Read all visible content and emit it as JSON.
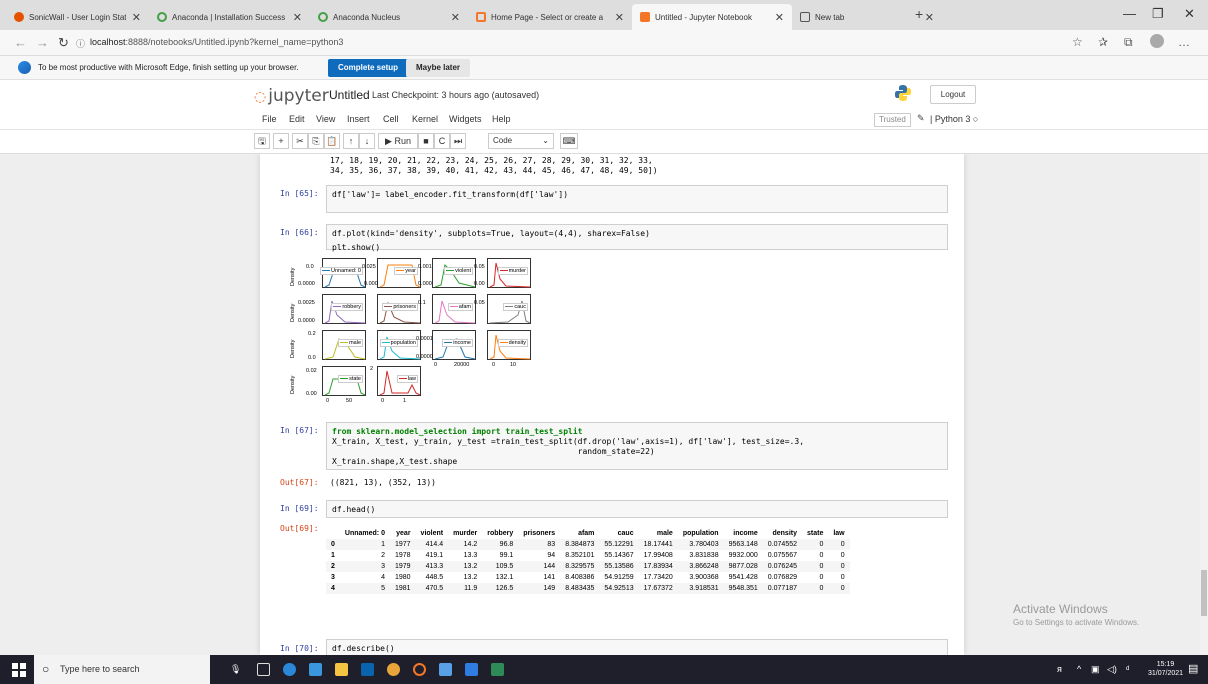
{
  "browser": {
    "tabs": [
      {
        "label": "SonicWall - User Login Status",
        "icon_color": "#e65100"
      },
      {
        "label": "Anaconda | Installation Success",
        "icon_color": "#43a047"
      },
      {
        "label": "Anaconda Nucleus",
        "icon_color": "#43a047"
      },
      {
        "label": "Home Page - Select or create a",
        "icon_color": "#f37726"
      },
      {
        "label": "Untitled - Jupyter Notebook",
        "icon_color": "#f37726"
      },
      {
        "label": "New tab",
        "icon_color": "#555555"
      }
    ],
    "active_tab_index": 4,
    "url_host": "localhost",
    "url_rest": ":8888/notebooks/Untitled.ipynb?kernel_name=python3",
    "info_message": "To be most productive with Microsoft Edge, finish setting up your browser.",
    "complete_setup_label": "Complete setup",
    "maybe_later_label": "Maybe later"
  },
  "jupyter": {
    "logo_text": "jupyter",
    "notebook_title": "Untitled",
    "checkpoint": "Last Checkpoint: 3 hours ago  (autosaved)",
    "logout_label": "Logout",
    "menu": [
      "File",
      "Edit",
      "View",
      "Insert",
      "Cell",
      "Kernel",
      "Widgets",
      "Help"
    ],
    "trusted_label": "Trusted",
    "kernel_label": "Python 3",
    "run_label": "Run",
    "cell_type": "Code"
  },
  "cells": {
    "top_output_line1": "17, 18, 19, 20, 21, 22, 23, 24, 25, 26, 27, 28, 29, 30, 31, 32, 33,",
    "top_output_line2": "34, 35, 36, 37, 38, 39, 40, 41, 42, 43, 44, 45, 46, 47, 48, 49, 50])",
    "c65_prompt": "In [65]:",
    "c65_code": "df['law']= label_encoder.fit_transform(df['law'])",
    "c66_prompt": "In [66]:",
    "c66_code_l1": "df.plot(kind='density', subplots=True, layout=(4,4), sharex=False)",
    "c66_code_l2": "plt.show()",
    "c67_prompt": "In [67]:",
    "c67_code_l1": "from sklearn.model_selection import train_test_split",
    "c67_code_l2": "X_train, X_test, y_train, y_test =train_test_split(df.drop('law',axis=1), df['law'], test_size=.3,",
    "c67_code_l3": "                                                   random_state=22)",
    "c67_code_l4": "X_train.shape,X_test.shape",
    "c67_out_prompt": "Out[67]:",
    "c67_out": "((821, 13), (352, 13))",
    "c69_prompt": "In [69]:",
    "c69_code": "df.head()",
    "c69_out_prompt": "Out[69]:",
    "c70_prompt": "In [70]:",
    "c70_code": "df.describe()"
  },
  "plot": {
    "legends": [
      "Unnamed: 0",
      "year",
      "violent",
      "murder",
      "robbery",
      "prisoners",
      "afam",
      "cauc",
      "male",
      "population",
      "income",
      "density",
      "state",
      "law"
    ],
    "legend_colors": [
      "#1f77b4",
      "#ff7f0e",
      "#2ca02c",
      "#d62728",
      "#9467bd",
      "#8c564b",
      "#e377c2",
      "#7f7f7f",
      "#bcbd22",
      "#17becf",
      "#1f77b4",
      "#ff7f0e",
      "#2ca02c",
      "#d62728"
    ],
    "y_label": "Density",
    "tick_labels": [
      "0.0",
      "0.0000",
      "0.0025",
      "0.0000",
      "0.2",
      "0.0",
      "0.02",
      "0.00",
      "0.025",
      "0.000",
      "0.001",
      "0.000",
      "0.05",
      "0.00",
      "0.1",
      "0.05",
      "0.0001",
      "0.0000",
      "0",
      "20000",
      "0",
      "10",
      "0",
      "50",
      "0",
      "1",
      "2"
    ]
  },
  "dataframe": {
    "columns": [
      "Unnamed: 0",
      "year",
      "violent",
      "murder",
      "robbery",
      "prisoners",
      "afam",
      "cauc",
      "male",
      "population",
      "income",
      "density",
      "state",
      "law"
    ],
    "rows": [
      {
        "index": "0",
        "values": [
          "1",
          "1977",
          "414.4",
          "14.2",
          "96.8",
          "83",
          "8.384873",
          "55.12291",
          "18.17441",
          "3.780403",
          "9563.148",
          "0.074552",
          "0",
          "0"
        ]
      },
      {
        "index": "1",
        "values": [
          "2",
          "1978",
          "419.1",
          "13.3",
          "99.1",
          "94",
          "8.352101",
          "55.14367",
          "17.99408",
          "3.831838",
          "9932.000",
          "0.075567",
          "0",
          "0"
        ]
      },
      {
        "index": "2",
        "values": [
          "3",
          "1979",
          "413.3",
          "13.2",
          "109.5",
          "144",
          "8.329575",
          "55.13586",
          "17.83934",
          "3.866248",
          "9877.028",
          "0.076245",
          "0",
          "0"
        ]
      },
      {
        "index": "3",
        "values": [
          "4",
          "1980",
          "448.5",
          "13.2",
          "132.1",
          "141",
          "8.408386",
          "54.91259",
          "17.73420",
          "3.900368",
          "9541.428",
          "0.076829",
          "0",
          "0"
        ]
      },
      {
        "index": "4",
        "values": [
          "5",
          "1981",
          "470.5",
          "11.9",
          "126.5",
          "149",
          "8.483435",
          "54.92513",
          "17.67372",
          "3.918531",
          "9548.351",
          "0.077187",
          "0",
          "0"
        ]
      }
    ]
  },
  "windows": {
    "activate_title": "Activate Windows",
    "activate_sub": "Go to Settings to activate Windows."
  },
  "taskbar": {
    "search_placeholder": "Type here to search",
    "time": "15:19",
    "date": "31/07/2021"
  }
}
